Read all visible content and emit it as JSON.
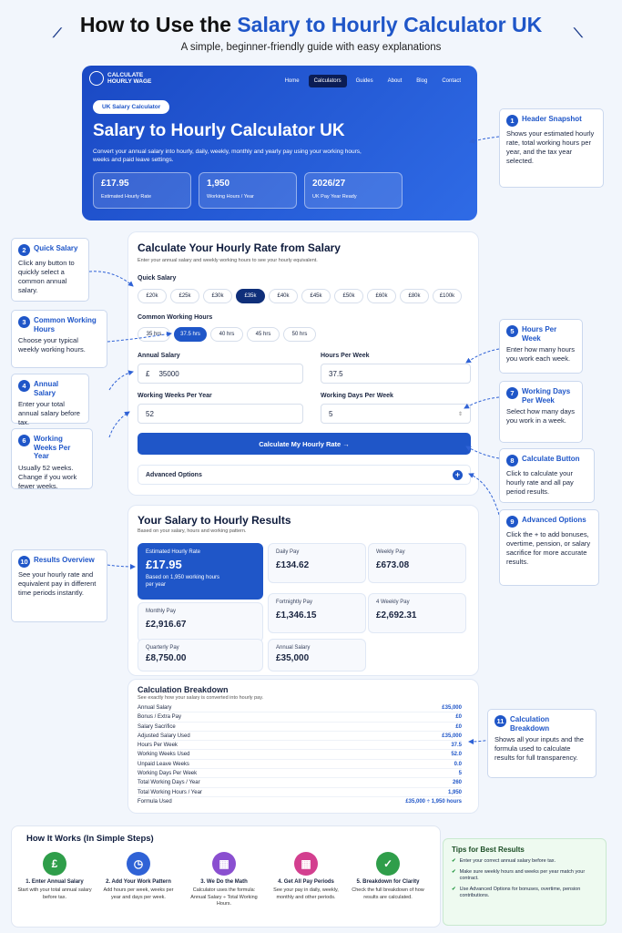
{
  "page": {
    "title_part1": "How to Use the ",
    "title_part2": "Salary to Hourly Calculator UK",
    "subtitle": "A simple, beginner-friendly guide with easy explanations"
  },
  "hero": {
    "logo_line1": "CALCULATE",
    "logo_line2": "HOURLY WAGE",
    "nav": [
      "Home",
      "Calculators",
      "Guides",
      "About",
      "Blog",
      "Contact"
    ],
    "nav_active_index": 1,
    "pill": "UK Salary Calculator",
    "heading": "Salary to Hourly Calculator UK",
    "description": "Convert your annual salary into hourly, daily, weekly, monthly and yearly pay using your working hours, weeks and paid leave settings.",
    "stats": [
      {
        "value": "£17.95",
        "label": "Estimated Hourly Rate"
      },
      {
        "value": "1,950",
        "label": "Working Hours / Year"
      },
      {
        "value": "2026/27",
        "label": "UK Pay Year Ready"
      }
    ]
  },
  "calc": {
    "heading": "Calculate Your Hourly Rate from Salary",
    "description": "Enter your annual salary and weekly working hours to see your hourly equivalent.",
    "quick_salary_label": "Quick Salary",
    "quick_salaries": [
      "£20k",
      "£25k",
      "£30k",
      "£35k",
      "£40k",
      "£45k",
      "£50k",
      "£60k",
      "£80k",
      "£100k"
    ],
    "quick_selected_index": 3,
    "hours_label": "Common Working Hours",
    "hours": [
      "35 hrs",
      "37.5 hrs",
      "40 hrs",
      "45 hrs",
      "50 hrs"
    ],
    "hours_selected_index": 1,
    "annual_salary_label": "Annual Salary",
    "currency": "£",
    "annual_salary_value": "35000",
    "hours_per_week_label": "Hours Per Week",
    "hours_per_week_value": "37.5",
    "weeks_label": "Working Weeks Per Year",
    "weeks_value": "52",
    "days_label": "Working Days Per Week",
    "days_value": "5",
    "button": "Calculate My Hourly Rate →",
    "advanced": "Advanced Options"
  },
  "results": {
    "heading": "Your Salary to Hourly Results",
    "description": "Based on your salary, hours and working pattern.",
    "main_label": "Estimated Hourly Rate",
    "main_value": "£17.95",
    "main_note": "Based on 1,950 working hours per year",
    "tiles": [
      {
        "label": "Daily Pay",
        "value": "£134.62"
      },
      {
        "label": "Weekly Pay",
        "value": "£673.08"
      },
      {
        "label": "Monthly Pay",
        "value": "£2,916.67"
      },
      {
        "label": "Fortnightly Pay",
        "value": "£1,346.15"
      },
      {
        "label": "4 Weekly Pay",
        "value": "£2,692.31"
      },
      {
        "label": "Quarterly Pay",
        "value": "£8,750.00"
      },
      {
        "label": "Annual Salary",
        "value": "£35,000"
      }
    ]
  },
  "breakdown": {
    "heading": "Calculation Breakdown",
    "description": "See exactly how your salary is converted into hourly pay.",
    "rows": [
      {
        "label": "Annual Salary",
        "value": "£35,000"
      },
      {
        "label": "Bonus / Extra Pay",
        "value": "£0"
      },
      {
        "label": "Salary Sacrifice",
        "value": "£0"
      },
      {
        "label": "Adjusted Salary Used",
        "value": "£35,000"
      },
      {
        "label": "Hours Per Week",
        "value": "37.5"
      },
      {
        "label": "Working Weeks Used",
        "value": "52.0"
      },
      {
        "label": "Unpaid Leave Weeks",
        "value": "0.0"
      },
      {
        "label": "Working Days Per Week",
        "value": "5"
      },
      {
        "label": "Total Working Days / Year",
        "value": "260"
      },
      {
        "label": "Total Working Hours / Year",
        "value": "1,950"
      },
      {
        "label": "Formula Used",
        "value": "£35,000 ÷ 1,950 hours"
      }
    ]
  },
  "callouts": [
    {
      "n": "1",
      "title": "Header Snapshot",
      "text": "Shows your estimated hourly rate, total working hours per year, and the tax year selected."
    },
    {
      "n": "2",
      "title": "Quick Salary",
      "text": "Click any button to quickly select a common annual salary."
    },
    {
      "n": "3",
      "title": "Common Working Hours",
      "text": "Choose your typical weekly working hours."
    },
    {
      "n": "4",
      "title": "Annual Salary",
      "text": "Enter your total annual salary before tax."
    },
    {
      "n": "5",
      "title": "Hours Per Week",
      "text": "Enter how many hours you work each week."
    },
    {
      "n": "6",
      "title": "Working Weeks Per Year",
      "text": "Usually 52 weeks. Change if you work fewer weeks."
    },
    {
      "n": "7",
      "title": "Working Days Per Week",
      "text": "Select how many days you work in a week."
    },
    {
      "n": "8",
      "title": "Calculate Button",
      "text": "Click to calculate your hourly rate and all pay period results."
    },
    {
      "n": "9",
      "title": "Advanced Options",
      "text": "Click the + to add bonuses, overtime, pension, or salary sacrifice for more accurate results."
    },
    {
      "n": "10",
      "title": "Results Overview",
      "text": "See your hourly rate and equivalent pay in different time periods instantly."
    },
    {
      "n": "11",
      "title": "Calculation Breakdown",
      "text": "Shows all your inputs and the formula used to calculate results for full transparency."
    }
  ],
  "how": {
    "heading": "How It Works (In Simple Steps)",
    "steps": [
      {
        "title": "1. Enter Annual Salary",
        "text": "Start with your total annual salary before tax.",
        "icon": "£",
        "color": "#2f9e4a"
      },
      {
        "title": "2. Add Your Work Pattern",
        "text": "Add hours per week, weeks per year and days per week.",
        "icon": "◷",
        "color": "#2f62d6"
      },
      {
        "title": "3. We Do the Math",
        "text": "Calculator uses the formula: Annual Salary ÷ Total Working Hours.",
        "icon": "▦",
        "color": "#8a4fd0"
      },
      {
        "title": "4. Get All Pay Periods",
        "text": "See your pay in daily, weekly, monthly and other periods.",
        "icon": "▦",
        "color": "#d33f8f"
      },
      {
        "title": "5. Breakdown for Clarity",
        "text": "Check the full breakdown of how results are calculated.",
        "icon": "✓",
        "color": "#2f9e4a"
      }
    ],
    "tips_title": "Tips for Best Results",
    "tips": [
      "Enter your correct annual salary before tax.",
      "Make sure weekly hours and weeks per year match your contract.",
      "Use Advanced Options for bonuses, overtime, pension contributions."
    ]
  }
}
